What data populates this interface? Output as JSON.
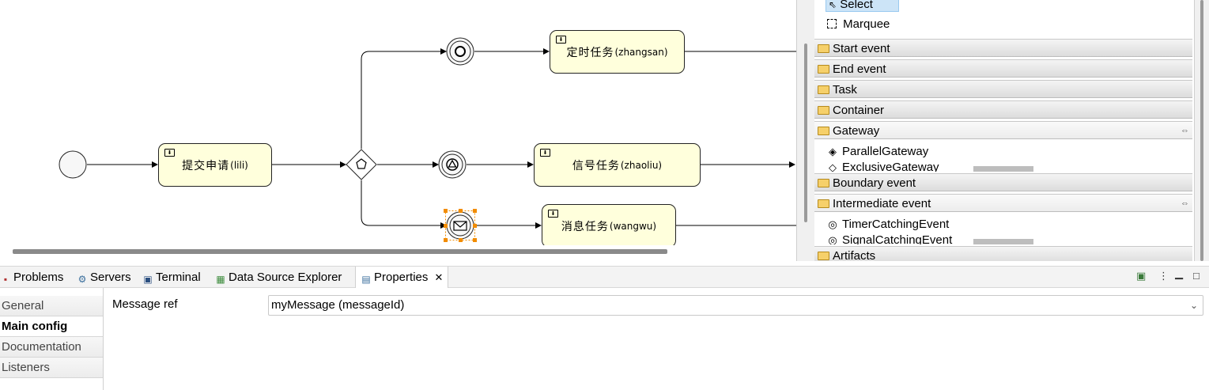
{
  "diagram": {
    "tasks": [
      {
        "name": "提交申请",
        "user": "(lili)"
      },
      {
        "name": "定时任务",
        "user": "(zhangsan)"
      },
      {
        "name": "信号任务",
        "user": "(zhaoliu)"
      },
      {
        "name": "消息任务",
        "user": "(wangwu)"
      }
    ]
  },
  "palette": {
    "tools": [
      "Select",
      "Marquee"
    ],
    "drawers": {
      "start_event": "Start event",
      "end_event": "End event",
      "task": "Task",
      "container": "Container",
      "gateway": "Gateway",
      "boundary_event": "Boundary event",
      "intermediate_event": "Intermediate event",
      "artifacts": "Artifacts"
    },
    "gateway_items": [
      "ParallelGateway",
      "ExclusiveGateway"
    ],
    "intermediate_items": [
      "TimerCatchingEvent",
      "SignalCatchingEvent"
    ]
  },
  "views": {
    "tabs": [
      "Problems",
      "Servers",
      "Terminal",
      "Data Source Explorer",
      "Properties"
    ]
  },
  "properties": {
    "side_tabs": [
      "General",
      "Main config",
      "Documentation",
      "Listeners"
    ],
    "selected_tab": "Main config",
    "field_label": "Message ref",
    "field_value": "myMessage (messageId)"
  },
  "colors": {
    "task_fill": "#ffffdc",
    "selection_handle": "#f28c00",
    "palette_selected": "#cce4f7"
  }
}
